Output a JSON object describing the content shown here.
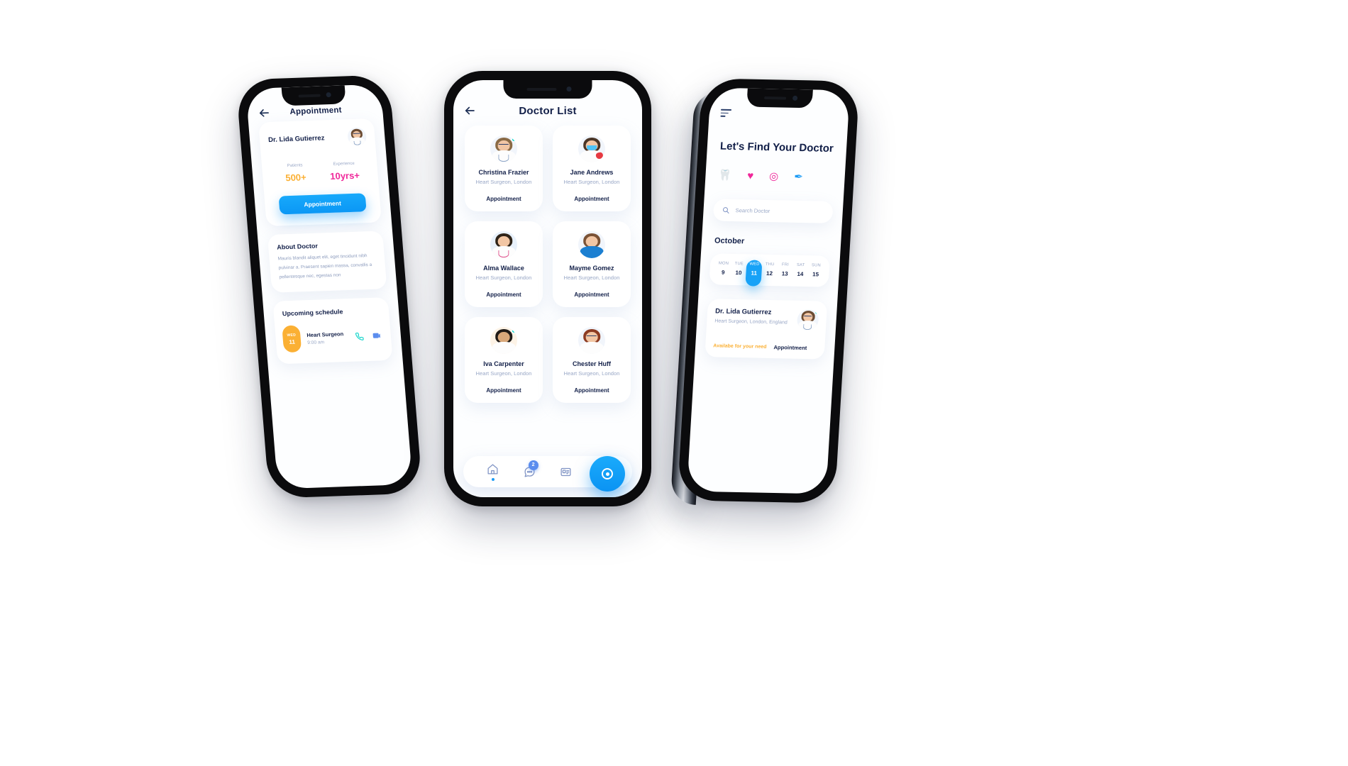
{
  "palette": {
    "accent_blue": "#17a2f7",
    "navy_text": "#132049",
    "muted_text": "#9aa8c7",
    "orange": "#fbb034",
    "pink": "#f0279a",
    "teal_dot": "#0ad3c8",
    "screen_bg": "#fdfeff"
  },
  "phone1": {
    "back_icon": "arrow-left-icon",
    "nav_title": "Appointment",
    "doctor": {
      "name": "Dr. Lida Gutierrez",
      "avatar_icon": "doctor-avatar"
    },
    "stats": [
      {
        "label": "Patients",
        "value": "500+",
        "color": "#fbb034"
      },
      {
        "label": "Experience",
        "value": "10yrs+",
        "color": "#f0279a"
      }
    ],
    "appointment_button": "Appointment",
    "about": {
      "title": "About Doctor",
      "body": "Mauris blandit aliquet elit, eget tincidunt nibh pulvinar a. Praesent sapien massa, convallis a pellentesque nec, egestas non"
    },
    "schedule": {
      "title": "Upcoming schedule",
      "items": [
        {
          "day_of_week": "WED",
          "day_number": "11",
          "title": "Heart Surgeon",
          "time": "9:00 am",
          "call_icon": "phone-icon",
          "video_icon": "video-chat-icon"
        }
      ]
    }
  },
  "phone2": {
    "back_icon": "arrow-left-icon",
    "nav_title": "Doctor List",
    "appointment_label": "Appointment",
    "doctors": [
      {
        "name": "Christina Frazier",
        "specialty": "Heart Surgeon, London",
        "online": true,
        "avatar_icon": "doctor-avatar-glasses-coat"
      },
      {
        "name": "Jane Andrews",
        "specialty": "Heart Surgeon, London",
        "online": false,
        "avatar_icon": "doctor-avatar-mask-heart"
      },
      {
        "name": "Alma Wallace",
        "specialty": "Heart Surgeon, London",
        "online": false,
        "avatar_icon": "doctor-avatar-coat-clipboard"
      },
      {
        "name": "Mayme Gomez",
        "specialty": "Heart Surgeon, London",
        "online": false,
        "avatar_icon": "doctor-avatar-blue-scrubs"
      },
      {
        "name": "Iva Carpenter",
        "specialty": "Heart Surgeon, London",
        "online": true,
        "avatar_icon": "doctor-avatar-bearded"
      },
      {
        "name": "Chester Huff",
        "specialty": "Heart Surgeon, London",
        "online": false,
        "avatar_icon": "doctor-avatar-red-hair"
      }
    ],
    "tabbar": {
      "items": [
        {
          "icon": "home-icon",
          "active": true,
          "badge": ""
        },
        {
          "icon": "chat-icon",
          "active": false,
          "badge": "2"
        },
        {
          "icon": "id-card-icon",
          "active": false,
          "badge": ""
        },
        {
          "icon": "medical-kit-icon",
          "active": false,
          "badge": ""
        }
      ],
      "fab_icon": "record-circle-icon"
    }
  },
  "phone3": {
    "menu_icon": "hamburger-menu-icon",
    "title": "Let's Find Your Doctor",
    "categories": [
      {
        "icon": "tooth-icon",
        "glyph": "🦷",
        "color": "#fbb034"
      },
      {
        "icon": "heartbeat-icon",
        "glyph": "♥",
        "color": "#f0279a"
      },
      {
        "icon": "eye-icon",
        "glyph": "◎",
        "color": "#f0279a"
      },
      {
        "icon": "syringe-icon",
        "glyph": "✐",
        "color": "#1b9bf5"
      }
    ],
    "search": {
      "icon": "search-icon",
      "placeholder": "Search Doctor",
      "value": ""
    },
    "calendar": {
      "month": "October",
      "days": [
        {
          "dow": "MON",
          "num": "9",
          "active": false
        },
        {
          "dow": "TUE",
          "num": "10",
          "active": false
        },
        {
          "dow": "WED",
          "num": "11",
          "active": true
        },
        {
          "dow": "THU",
          "num": "12",
          "active": false
        },
        {
          "dow": "FRI",
          "num": "13",
          "active": false
        },
        {
          "dow": "SAT",
          "num": "14",
          "active": false
        },
        {
          "dow": "SUN",
          "num": "15",
          "active": false
        }
      ]
    },
    "doctor_card": {
      "name": "Dr. Lida Gutierrez",
      "specialty": "Heart Surgeon, London, England",
      "availability": "Availabe for your need",
      "appointment_label": "Appointment",
      "avatar_icon": "doctor-avatar-female",
      "online": true
    }
  }
}
